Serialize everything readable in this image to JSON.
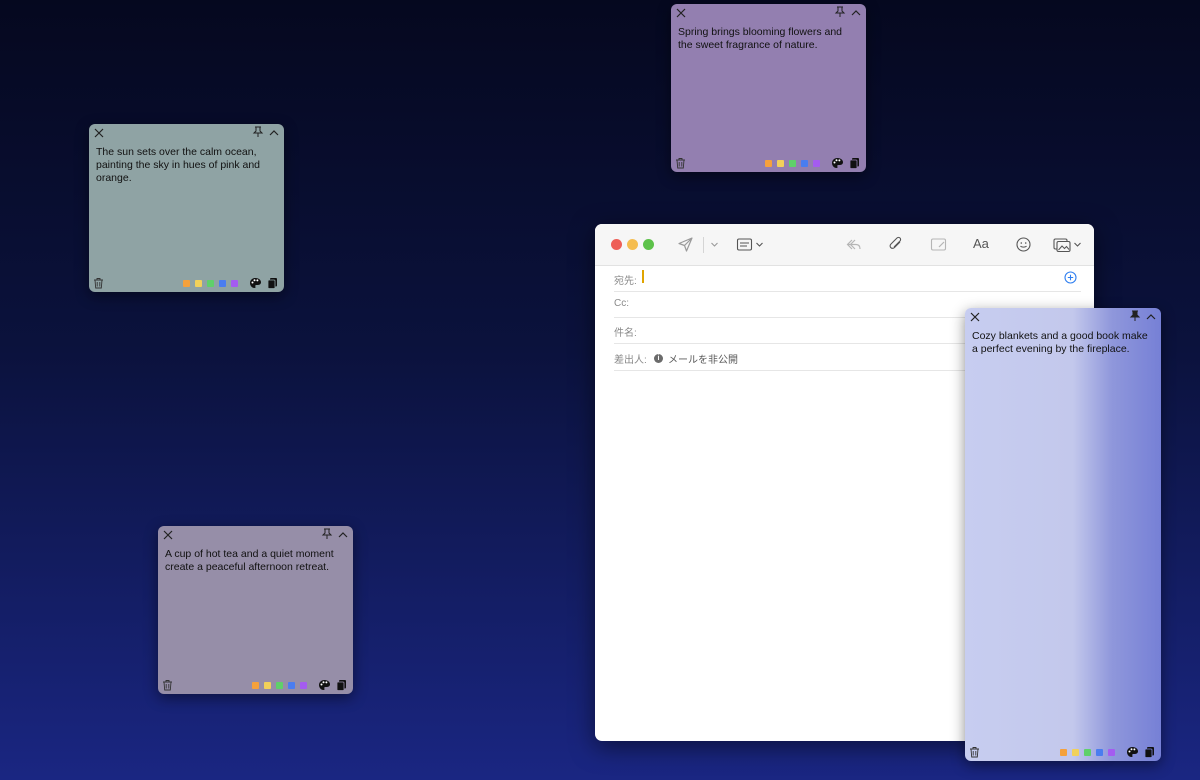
{
  "notes": [
    {
      "id": "sunset",
      "text": "The sun sets over the calm ocean, painting the sky in hues of pink and orange.",
      "color": "#8fa3a4"
    },
    {
      "id": "spring",
      "text": "Spring brings blooming flowers and the sweet fragrance of nature.",
      "color": "#937fb0"
    },
    {
      "id": "tea",
      "text": "A cup of hot tea and a quiet moment create a peaceful afternoon retreat.",
      "color": "#968ea8"
    },
    {
      "id": "cozy",
      "text": "Cozy blankets and a good book make a perfect evening by the fireplace.",
      "color": "#c3c9ec"
    }
  ],
  "swatch_colors": [
    "#f5a13c",
    "#f1d15a",
    "#5fd06a",
    "#4a7df0",
    "#a45cf0"
  ],
  "mail": {
    "fields": {
      "to_label": "宛先:",
      "cc_label": "Cc:",
      "subject_label": "件名:",
      "from_label": "差出人:",
      "from_value": "メールを非公開"
    },
    "format_label": "Aa"
  }
}
